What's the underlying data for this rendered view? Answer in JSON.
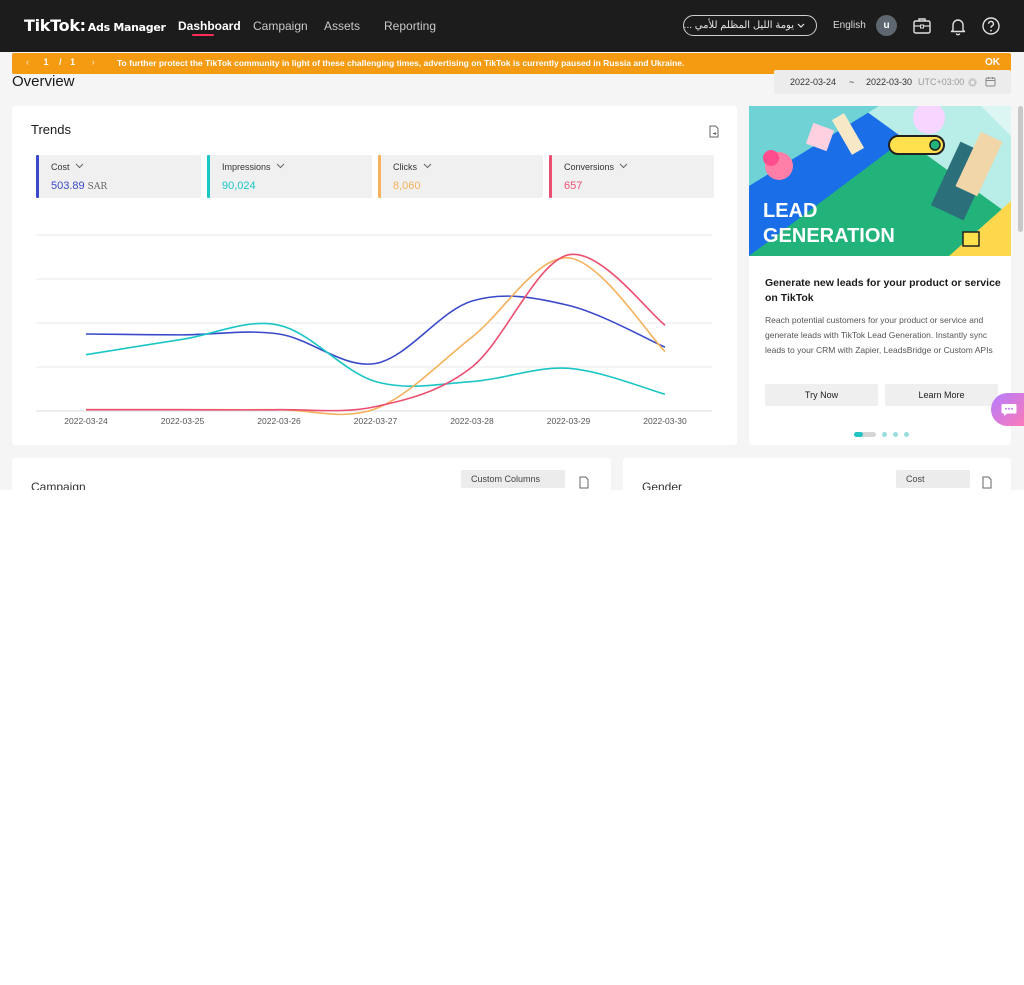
{
  "brand": {
    "logo": "TikTok",
    "logo_dot": ":",
    "product": "Ads Manager"
  },
  "nav": {
    "items": [
      "Dashboard",
      "Campaign",
      "Assets",
      "Reporting"
    ],
    "active": "Dashboard"
  },
  "header": {
    "account_name": "يومة الليل المظلم للأمي ...",
    "language": "English",
    "avatar_initial": "u",
    "icons": [
      "chevron-down-icon",
      "briefcase-icon",
      "bell-icon",
      "help-icon"
    ]
  },
  "banner": {
    "page_current": "1",
    "page_sep": "/",
    "page_total": "1",
    "message": "To further protect the TikTok community in light of these challenging times, advertising on TikTok is currently paused in Russia and Ukraine.",
    "ok_label": "OK",
    "color": "#f59b12"
  },
  "overview": {
    "title": "Overview",
    "date_start": "2022-03-24",
    "date_sep": "~",
    "date_end": "2022-03-30",
    "timezone": "UTC+03:00"
  },
  "trends": {
    "title": "Trends",
    "metrics": [
      {
        "label": "Cost",
        "value": "503.89",
        "unit": "SAR",
        "color": "#3949c9"
      },
      {
        "label": "Impressions",
        "value": "90,024",
        "unit": "",
        "color": "#1bc6c6"
      },
      {
        "label": "Clicks",
        "value": "8,060",
        "unit": "",
        "color": "#f5b15b"
      },
      {
        "label": "Conversions",
        "value": "657",
        "unit": "",
        "color": "#ec4f72"
      }
    ]
  },
  "chart_data": {
    "type": "line",
    "x": [
      "2022-03-24",
      "2022-03-25",
      "2022-03-26",
      "2022-03-27",
      "2022-03-28",
      "2022-03-29",
      "2022-03-30"
    ],
    "ylim": [
      0,
      4
    ],
    "grid": true,
    "series": [
      {
        "name": "Cost",
        "color": "#3949c9",
        "values": [
          1.75,
          1.73,
          1.75,
          1.08,
          2.5,
          2.4,
          1.45
        ]
      },
      {
        "name": "Impressions",
        "color": "#1bc6c6",
        "values": [
          1.28,
          1.63,
          1.95,
          0.67,
          0.67,
          0.97,
          0.38
        ]
      },
      {
        "name": "Clicks",
        "color": "#f5b15b",
        "values": [
          0.03,
          0.03,
          0.03,
          0.05,
          1.68,
          3.48,
          1.35
        ]
      },
      {
        "name": "Conversions",
        "color": "#ec4f72",
        "values": [
          0.03,
          0.03,
          0.03,
          0.1,
          1.0,
          3.55,
          1.95
        ]
      }
    ]
  },
  "promo": {
    "image_text_1": "LEAD",
    "image_text_2": "GENERATION",
    "headline": "Generate new leads for your product or service on TikTok",
    "body": "Reach potential customers for your product or service and generate leads with TikTok Lead Generation. Instantly sync leads to your CRM with Zapier, LeadsBridge or Custom APIs",
    "primary_button": "Try Now",
    "secondary_button": "Learn More",
    "slide_count": 4,
    "active_slide": 1
  },
  "lower": {
    "left_title": "Campaign",
    "left_button": "Custom Columns",
    "right_title": "Gender",
    "right_button": "Cost"
  }
}
